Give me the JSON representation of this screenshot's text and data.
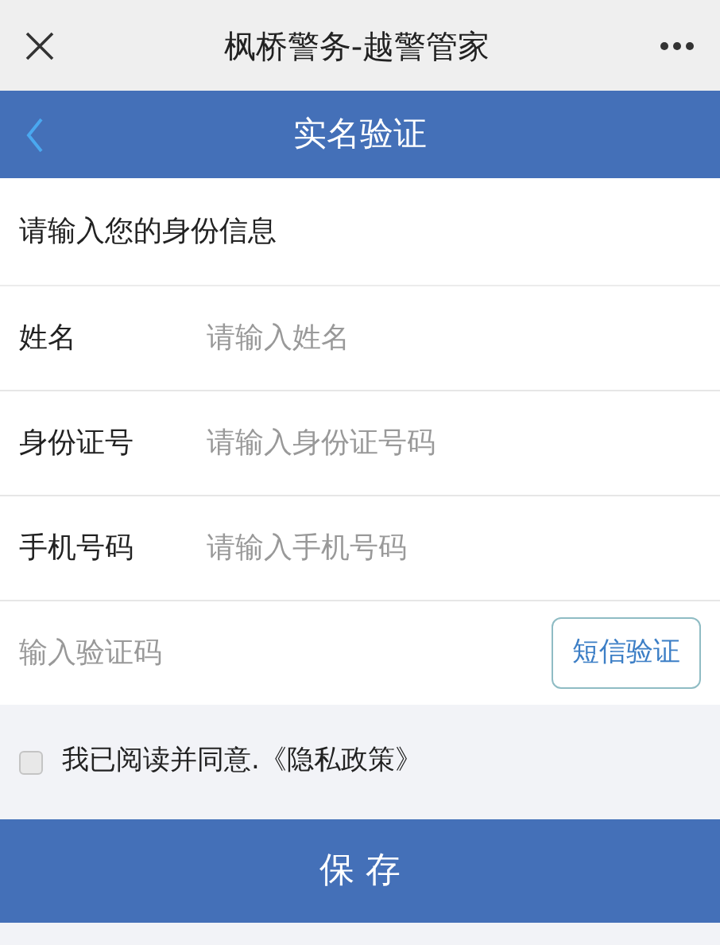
{
  "top_bar": {
    "title": "枫桥警务-越警管家"
  },
  "header": {
    "title": "实名验证"
  },
  "section_title": "请输入您的身份信息",
  "fields": [
    {
      "label": "姓名",
      "placeholder": "请输入姓名"
    },
    {
      "label": "身份证号",
      "placeholder": "请输入身份证号码"
    },
    {
      "label": "手机号码",
      "placeholder": "请输入手机号码"
    }
  ],
  "code": {
    "placeholder": "输入验证码",
    "button": "短信验证"
  },
  "agreement": {
    "text": "我已阅读并同意.《隐私政策》",
    "checked": false
  },
  "save_button": "保 存"
}
